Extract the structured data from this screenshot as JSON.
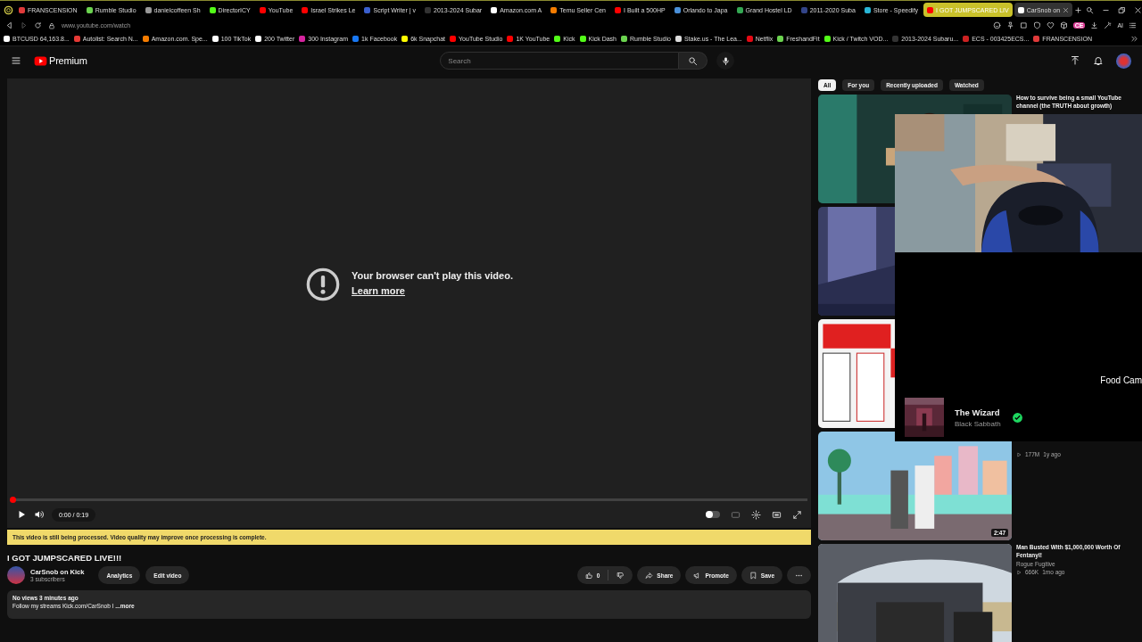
{
  "browser": {
    "tabs": [
      {
        "label": "FRANSCENSION",
        "color": "#e03a3a",
        "selected": false,
        "highlighted": false
      },
      {
        "label": "Rumble Studio",
        "color": "#6bd34f",
        "selected": false,
        "highlighted": false
      },
      {
        "label": "danielcoffeen Sh",
        "color": "#999999",
        "selected": false,
        "highlighted": false
      },
      {
        "label": "DirectorICY",
        "color": "#53fc18",
        "selected": false,
        "highlighted": false
      },
      {
        "label": "YouTube",
        "color": "#ff0000",
        "selected": false,
        "highlighted": false
      },
      {
        "label": "Israel Strikes Le",
        "color": "#ff0000",
        "selected": false,
        "highlighted": false
      },
      {
        "label": "Script Writer | v",
        "color": "#3a5fcd",
        "selected": false,
        "highlighted": false
      },
      {
        "label": "2013-2024 Subar",
        "color": "#333333",
        "selected": false,
        "highlighted": false
      },
      {
        "label": "Amazon.com A",
        "color": "#ffffff",
        "selected": false,
        "highlighted": false
      },
      {
        "label": "Temu Seller Cen",
        "color": "#f57c00",
        "selected": false,
        "highlighted": false
      },
      {
        "label": "I Built a 500HP",
        "color": "#ff0000",
        "selected": false,
        "highlighted": false
      },
      {
        "label": "Orlando to Japa",
        "color": "#4a90d9",
        "selected": false,
        "highlighted": false
      },
      {
        "label": "Grand Hostel LD",
        "color": "#34a853",
        "selected": false,
        "highlighted": false
      },
      {
        "label": "2011-2020 Suba",
        "color": "#334488",
        "selected": false,
        "highlighted": false
      },
      {
        "label": "Store - Speedify",
        "color": "#29b6d6",
        "selected": false,
        "highlighted": false
      },
      {
        "label": "I GOT JUMPSCARED LIV",
        "color": "#ff0000",
        "selected": false,
        "highlighted": true
      },
      {
        "label": "CarSnob on",
        "color": "#ffffff",
        "selected": true,
        "highlighted": false
      }
    ],
    "address": "www.youtube.com/watch",
    "extension_badge": "CE",
    "toolbar_label": "AI",
    "bookmarks": [
      {
        "label": "BTCUSD 64,163.8...",
        "color": "#ffffff"
      },
      {
        "label": "Autolist: Search N...",
        "color": "#e53935"
      },
      {
        "label": "Amazon.com. Spe...",
        "color": "#f57c00"
      },
      {
        "label": "100 TikTok",
        "color": "#ffffff"
      },
      {
        "label": "200 Twitter",
        "color": "#ffffff"
      },
      {
        "label": "300 Instagram",
        "color": "#d6249f"
      },
      {
        "label": "1k Facebook",
        "color": "#1877f2"
      },
      {
        "label": "6k Snapchat",
        "color": "#fffc00"
      },
      {
        "label": "YouTube Studio",
        "color": "#ff0000"
      },
      {
        "label": "1K YouTube",
        "color": "#ff0000"
      },
      {
        "label": "Kick",
        "color": "#53fc18"
      },
      {
        "label": "Kick Dash",
        "color": "#53fc18"
      },
      {
        "label": "Rumble Studio",
        "color": "#6bd34f"
      },
      {
        "label": "Stake.us - The Lea...",
        "color": "#dddddd"
      },
      {
        "label": "Netflix",
        "color": "#e50914"
      },
      {
        "label": "FreshandFit",
        "color": "#6bd34f"
      },
      {
        "label": "Kick / Twitch VOD...",
        "color": "#53fc18"
      },
      {
        "label": "2013-2024 Subaru...",
        "color": "#333333"
      },
      {
        "label": "ECS - 003425ECS...",
        "color": "#cc2222"
      },
      {
        "label": "FRANSCENSION",
        "color": "#e03a3a"
      }
    ]
  },
  "header": {
    "logo_text": "Premium",
    "search": {
      "placeholder": "Search"
    }
  },
  "player": {
    "message": "Your browser can't play this video.",
    "link": "Learn more",
    "progress": {
      "level": 0
    },
    "time": "0:00 / 0:19",
    "autoplay": {
      "on": false
    }
  },
  "notice": "This video is still being processed. Video quality may improve once processing is complete.",
  "video": {
    "title": "I GOT JUMPSCARED LIVE!!!",
    "channel": "CarSnob on Kick",
    "subscribers": "3 subscribers",
    "owner_buttons": [
      "Analytics",
      "Edit video"
    ],
    "likes": "0",
    "actions": [
      "Share",
      "Promote",
      "Save"
    ],
    "description": {
      "stats": "No views  3 minutes ago",
      "text": "Follow my streams Kick.com/CarSnob I ",
      "more": "...more"
    }
  },
  "sidebar": {
    "chips": [
      {
        "label": "All",
        "selected": true
      },
      {
        "label": "For you",
        "selected": false
      },
      {
        "label": "Recently uploaded",
        "selected": false
      },
      {
        "label": "Watched",
        "selected": false
      }
    ],
    "videos": [
      {
        "thumbnail": {
          "kind": "picture"
        },
        "title": "How to survive being a small YouTube channel (the TRUTH about growth)"
      },
      {
        "thumbnail": {
          "kind": "picture"
        }
      },
      {
        "thumbnail": {
          "kind": "picture"
        }
      },
      {
        "thumbnail": {
          "kind": "picture"
        },
        "views": "177M",
        "age": "1y ago",
        "duration": "2:47"
      },
      {
        "thumbnail": {
          "kind": "picture"
        },
        "title": "Man Busted With $1,000,000 Worth Of Fentanyl!",
        "channel": "Rogue Fugitive",
        "views": "666K",
        "age": "1mo ago"
      }
    ]
  },
  "overlay": {
    "label": "Food Cam",
    "now_playing": {
      "song": "The Wizard",
      "artist": "Black Sabbath",
      "saved": true
    }
  }
}
